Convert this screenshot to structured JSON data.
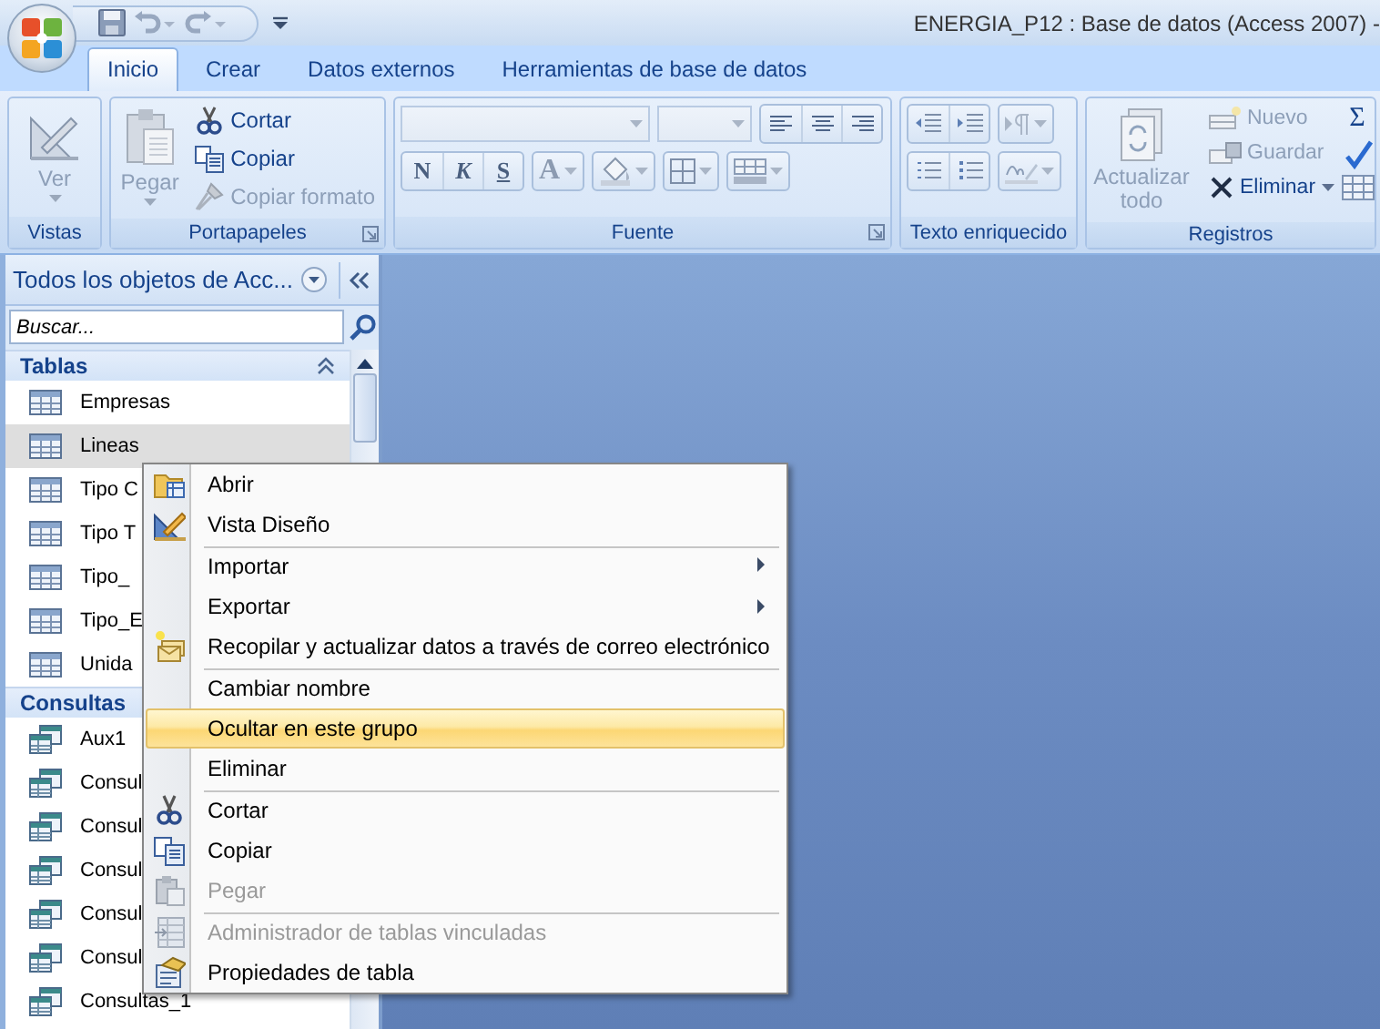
{
  "title_bar": {
    "title": "ENERGIA_P12 : Base de datos (Access 2007) -"
  },
  "tabs": [
    {
      "label": "Inicio",
      "selected": true
    },
    {
      "label": "Crear",
      "selected": false
    },
    {
      "label": "Datos externos",
      "selected": false
    },
    {
      "label": "Herramientas de base de datos",
      "selected": false
    }
  ],
  "ribbon": {
    "groups": [
      {
        "kind": "views",
        "label": "Vistas",
        "button": {
          "label": "Ver",
          "disabled": true
        }
      },
      {
        "kind": "clipboard",
        "label": "Portapapeles",
        "large": {
          "label": "Pegar",
          "disabled": true
        },
        "small": [
          {
            "label": "Cortar",
            "disabled": false
          },
          {
            "label": "Copiar",
            "disabled": false
          },
          {
            "label": "Copiar formato",
            "disabled": true
          }
        ]
      },
      {
        "kind": "font",
        "label": "Fuente",
        "format_buttons": [
          "N",
          "K",
          "S"
        ],
        "font_color_button": "A"
      },
      {
        "kind": "richtext",
        "label": "Texto enriquecido"
      },
      {
        "kind": "records",
        "label": "Registros",
        "large": {
          "label": "Actualizar todo",
          "disabled": true
        },
        "small": [
          {
            "label": "Nuevo",
            "disabled": true
          },
          {
            "label": "Guardar",
            "disabled": true
          },
          {
            "label": "Eliminar",
            "disabled": false
          }
        ],
        "totals": "Σ"
      }
    ]
  },
  "navigation_pane": {
    "header": "Todos los objetos de Acc...",
    "search": {
      "placeholder": "Buscar..."
    },
    "groups": [
      {
        "label": "Tablas",
        "kind": "tables",
        "items": [
          {
            "label": "Empresas",
            "selected": false
          },
          {
            "label": "Lineas",
            "selected": true
          },
          {
            "label": "Tipo C",
            "selected": false
          },
          {
            "label": "Tipo T",
            "selected": false
          },
          {
            "label": "Tipo_",
            "selected": false
          },
          {
            "label": "Tipo_E",
            "selected": false
          },
          {
            "label": "Unida",
            "selected": false
          }
        ]
      },
      {
        "label": "Consultas",
        "kind": "queries",
        "items": [
          {
            "label": "Aux1",
            "selected": false
          },
          {
            "label": "Consul",
            "selected": false
          },
          {
            "label": "Consul",
            "selected": false
          },
          {
            "label": "Consul",
            "selected": false
          },
          {
            "label": "Consul",
            "selected": false
          },
          {
            "label": "Consul",
            "selected": false
          },
          {
            "label": "Consultas_1",
            "selected": false
          }
        ]
      }
    ]
  },
  "context_menu": {
    "items": [
      {
        "label": "Abrir",
        "disabled": false,
        "selected": false,
        "submenu": false,
        "separator_before": false
      },
      {
        "label": "Vista Diseño",
        "disabled": false,
        "selected": false,
        "submenu": false,
        "separator_before": false
      },
      {
        "label": "Importar",
        "disabled": false,
        "selected": false,
        "submenu": true,
        "separator_before": true
      },
      {
        "label": "Exportar",
        "disabled": false,
        "selected": false,
        "submenu": true,
        "separator_before": false
      },
      {
        "label": "Recopilar y actualizar datos a través de correo electrónico",
        "disabled": false,
        "selected": false,
        "submenu": false,
        "separator_before": false
      },
      {
        "label": "Cambiar nombre",
        "disabled": false,
        "selected": false,
        "submenu": false,
        "separator_before": true
      },
      {
        "label": "Ocultar en este grupo",
        "disabled": false,
        "selected": true,
        "submenu": false,
        "separator_before": false
      },
      {
        "label": "Eliminar",
        "disabled": false,
        "selected": false,
        "submenu": false,
        "separator_before": false
      },
      {
        "label": "Cortar",
        "disabled": false,
        "selected": false,
        "submenu": false,
        "separator_before": true
      },
      {
        "label": "Copiar",
        "disabled": false,
        "selected": false,
        "submenu": false,
        "separator_before": false
      },
      {
        "label": "Pegar",
        "disabled": true,
        "selected": false,
        "submenu": false,
        "separator_before": false
      },
      {
        "label": "Administrador de tablas vinculadas",
        "disabled": true,
        "selected": false,
        "submenu": false,
        "separator_before": true
      },
      {
        "label": "Propiedades de tabla",
        "disabled": false,
        "selected": false,
        "submenu": false,
        "separator_before": false
      }
    ]
  }
}
